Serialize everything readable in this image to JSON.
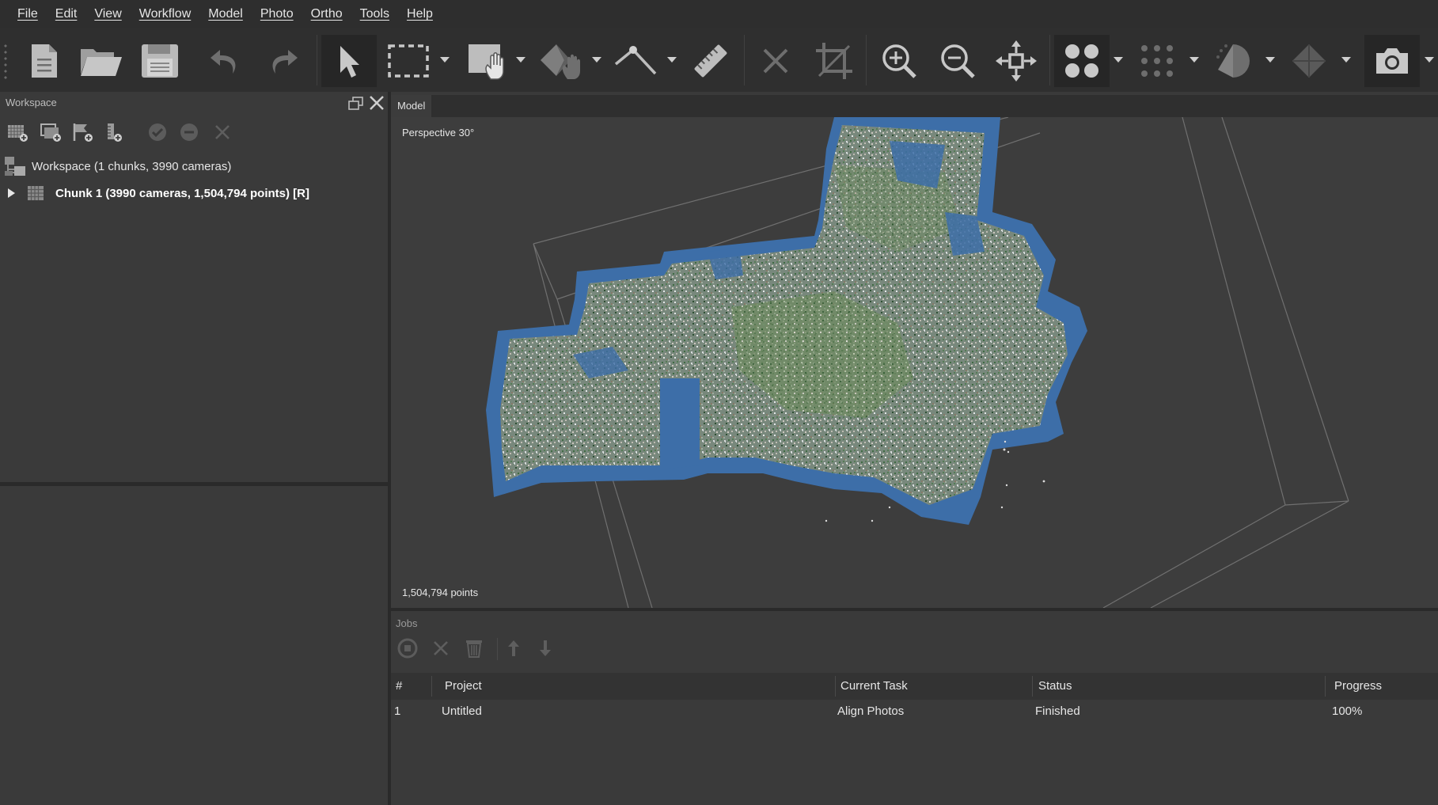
{
  "menu": [
    "File",
    "Edit",
    "View",
    "Workflow",
    "Model",
    "Photo",
    "Ortho",
    "Tools",
    "Help"
  ],
  "toolbar": {
    "icons": [
      "new-document-icon",
      "open-folder-icon",
      "save-icon",
      "undo-icon",
      "redo-icon",
      "select-pointer-icon",
      "rectangle-selection-icon",
      "navigation-hand-icon",
      "polygon-draw-icon",
      "point-line-icon",
      "ruler-icon",
      "delete-selection-icon",
      "crop-icon",
      "zoom-in-icon",
      "zoom-out-icon",
      "reset-view-icon",
      "point-cloud-view-icon",
      "sparse-cloud-icon",
      "shaded-model-icon",
      "model-view-icon",
      "camera-icon"
    ]
  },
  "workspace": {
    "title": "Workspace",
    "tree": {
      "root_label": "Workspace (1 chunks, 3990 cameras)",
      "chunk_label": "Chunk 1 (3990 cameras, 1,504,794 points) [R]"
    }
  },
  "model": {
    "tab_label": "Model",
    "perspective_label": "Perspective 30°",
    "points_label": "1,504,794 points"
  },
  "jobs": {
    "title": "Jobs",
    "columns": [
      "#",
      "Project",
      "Current Task",
      "Status",
      "Progress"
    ],
    "rows": [
      {
        "num": "1",
        "project": "Untitled",
        "task": "Align Photos",
        "status": "Finished",
        "progress": "100%"
      }
    ]
  },
  "colors": {
    "background": "#3a3a3a",
    "menubar": "#2e2e2e",
    "cloud_blue": "#3d6ea8",
    "text": "#e6e6e6"
  }
}
